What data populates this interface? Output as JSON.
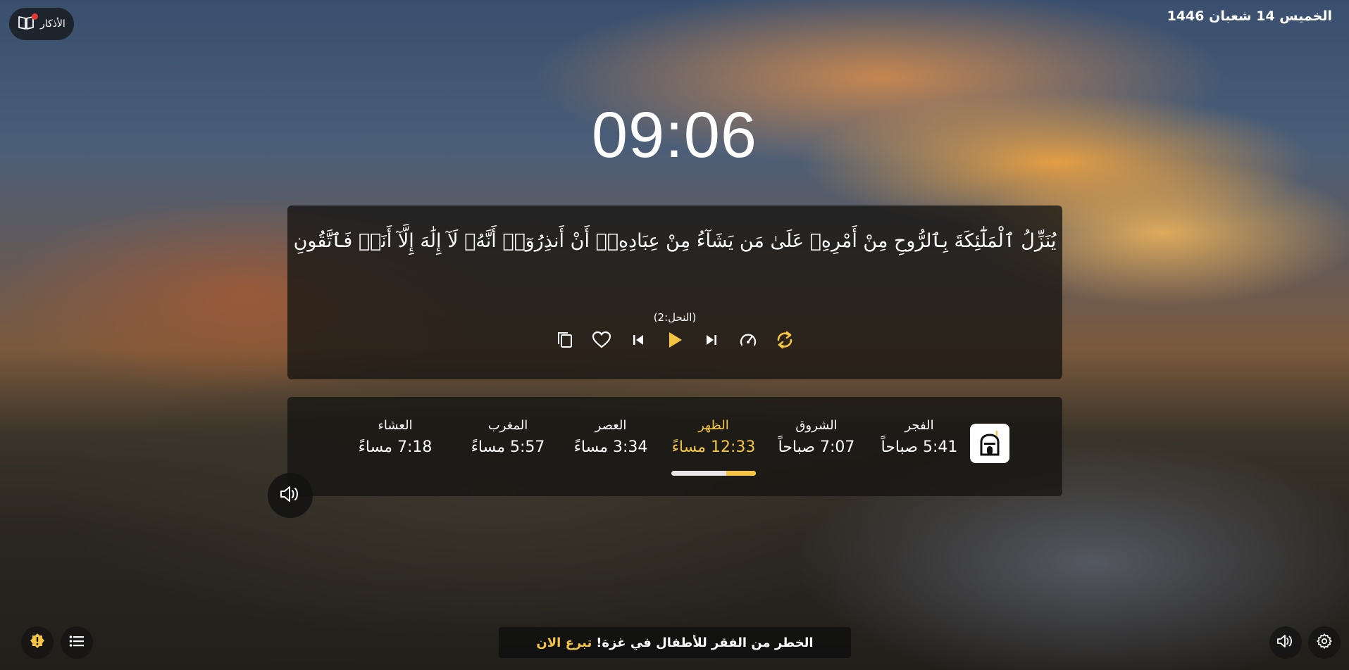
{
  "header": {
    "athkar_label": "الأذكار",
    "date": "الخميس 14 شعبان 1446"
  },
  "clock": {
    "time": "09:06"
  },
  "verse": {
    "text": "يُنَزِّلُ ٱلْمَلَٰٓئِكَةَ بِٱلرُّوحِ مِنْ أَمْرِهِۦ عَلَىٰ مَن يَشَآءُ مِنْ عِبَادِهِۦٓ أَنْ أَنذِرُوٓا۟ أَنَّهُۥ لَآ إِلَٰهَ إِلَّآ أَنَا۠ فَٱتَّقُونِ",
    "reference": "(النحل:2)"
  },
  "player": {
    "icons": [
      "copy-icon",
      "heart-icon",
      "previous-icon",
      "play-icon",
      "next-icon",
      "speed-icon",
      "repeat-icon"
    ]
  },
  "prayers": {
    "items": [
      {
        "name": "الفجر",
        "time": "5:41 صباحاً",
        "active": false
      },
      {
        "name": "الشروق",
        "time": "7:07 صباحاً",
        "active": false
      },
      {
        "name": "الظهر",
        "time": "12:33 مساءً",
        "active": true
      },
      {
        "name": "العصر",
        "time": "3:34 مساءً",
        "active": false
      },
      {
        "name": "المغرب",
        "time": "5:57 مساءً",
        "active": false
      },
      {
        "name": "العشاء",
        "time": "7:18 مساءً",
        "active": false
      }
    ],
    "progress_fraction": 0.35
  },
  "banner": {
    "text": "الخطر من الفقر للأطفال في غزة!",
    "cta": "تبرع الان"
  },
  "colors": {
    "accent": "#f5c542",
    "notification": "#e53935",
    "panel": "#161412"
  }
}
